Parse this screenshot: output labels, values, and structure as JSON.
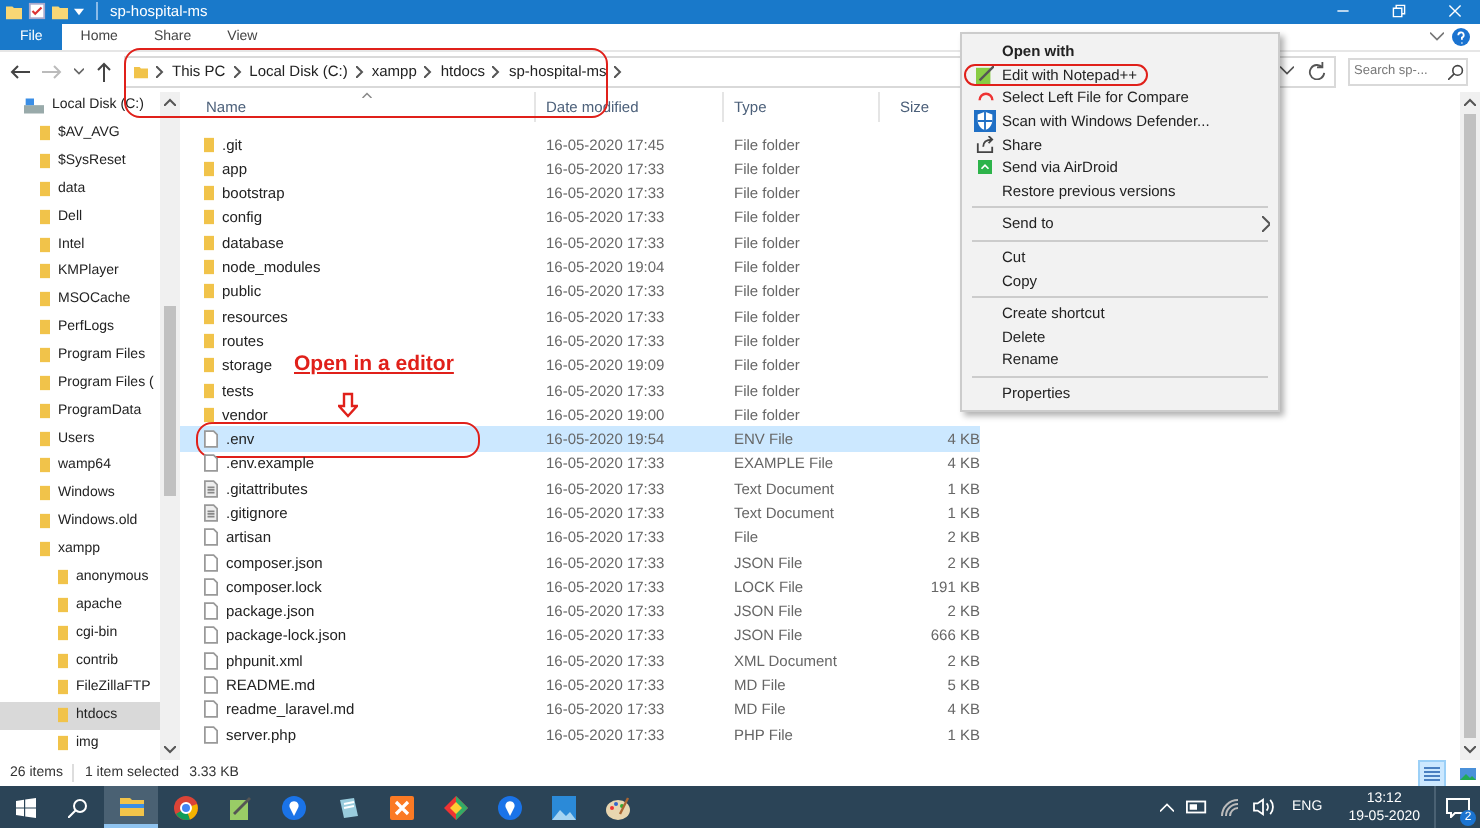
{
  "window": {
    "title": "sp-hospital-ms"
  },
  "ribbon": {
    "tabs": [
      {
        "label": "File",
        "selected": true
      },
      {
        "label": "Home",
        "selected": false
      },
      {
        "label": "Share",
        "selected": false
      },
      {
        "label": "View",
        "selected": false
      }
    ]
  },
  "address_bar": {
    "circled": true,
    "crumbs": [
      "This PC",
      "Local Disk (C:)",
      "xampp",
      "htdocs",
      "sp-hospital-ms"
    ]
  },
  "search": {
    "placeholder": "Search sp-..."
  },
  "sidebar": {
    "items": [
      {
        "label": "Local Disk (C:)",
        "kind": "drive",
        "selected": false,
        "children": [
          {
            "label": "$AV_AVG",
            "kind": "folder",
            "selected": false
          },
          {
            "label": "$SysReset",
            "kind": "folder",
            "selected": false
          },
          {
            "label": "data",
            "kind": "folder",
            "selected": false
          },
          {
            "label": "Dell",
            "kind": "folder",
            "selected": false
          },
          {
            "label": "Intel",
            "kind": "folder",
            "selected": false
          },
          {
            "label": "KMPlayer",
            "kind": "folder",
            "selected": false
          },
          {
            "label": "MSOCache",
            "kind": "folder",
            "selected": false
          },
          {
            "label": "PerfLogs",
            "kind": "folder",
            "selected": false
          },
          {
            "label": "Program Files",
            "kind": "folder",
            "selected": false
          },
          {
            "label": "Program Files (",
            "kind": "folder",
            "selected": false
          },
          {
            "label": "ProgramData",
            "kind": "folder",
            "selected": false
          },
          {
            "label": "Users",
            "kind": "folder",
            "selected": false
          },
          {
            "label": "wamp64",
            "kind": "folder",
            "selected": false
          },
          {
            "label": "Windows",
            "kind": "folder",
            "selected": false
          },
          {
            "label": "Windows.old",
            "kind": "folder",
            "selected": false
          },
          {
            "label": "xampp",
            "kind": "folder",
            "selected": false,
            "children": [
              {
                "label": "anonymous",
                "kind": "folder",
                "selected": false
              },
              {
                "label": "apache",
                "kind": "folder",
                "selected": false
              },
              {
                "label": "cgi-bin",
                "kind": "folder",
                "selected": false
              },
              {
                "label": "contrib",
                "kind": "folder",
                "selected": false
              },
              {
                "label": "FileZillaFTP",
                "kind": "folder",
                "selected": false
              },
              {
                "label": "htdocs",
                "kind": "folder",
                "selected": true
              },
              {
                "label": "img",
                "kind": "folder",
                "selected": false
              }
            ]
          }
        ]
      }
    ]
  },
  "table": {
    "columns": [
      "Name",
      "Date modified",
      "Type",
      "Size"
    ],
    "rows": [
      {
        "name": ".git",
        "date": "16-05-2020 17:45",
        "type": "File folder",
        "kind": "folder",
        "selected": false,
        "circled": false
      },
      {
        "name": "app",
        "date": "16-05-2020 17:33",
        "type": "File folder",
        "kind": "folder",
        "selected": false,
        "circled": false
      },
      {
        "name": "bootstrap",
        "date": "16-05-2020 17:33",
        "type": "File folder",
        "kind": "folder",
        "selected": false,
        "circled": false
      },
      {
        "name": "config",
        "date": "16-05-2020 17:33",
        "type": "File folder",
        "kind": "folder",
        "selected": false,
        "circled": false
      },
      {
        "name": "database",
        "date": "16-05-2020 17:33",
        "type": "File folder",
        "kind": "folder",
        "selected": false,
        "circled": false
      },
      {
        "name": "node_modules",
        "date": "16-05-2020 19:04",
        "type": "File folder",
        "kind": "folder",
        "selected": false,
        "circled": false
      },
      {
        "name": "public",
        "date": "16-05-2020 17:33",
        "type": "File folder",
        "kind": "folder",
        "selected": false,
        "circled": false
      },
      {
        "name": "resources",
        "date": "16-05-2020 17:33",
        "type": "File folder",
        "kind": "folder",
        "selected": false,
        "circled": false
      },
      {
        "name": "routes",
        "date": "16-05-2020 17:33",
        "type": "File folder",
        "kind": "folder",
        "selected": false,
        "circled": false
      },
      {
        "name": "storage",
        "date": "16-05-2020 19:09",
        "type": "File folder",
        "kind": "folder",
        "selected": false,
        "circled": false
      },
      {
        "name": "tests",
        "date": "16-05-2020 17:33",
        "type": "File folder",
        "kind": "folder",
        "selected": false,
        "circled": false
      },
      {
        "name": "vendor",
        "date": "16-05-2020 19:00",
        "type": "File folder",
        "kind": "folder",
        "selected": false,
        "circled": false
      },
      {
        "name": ".env",
        "date": "16-05-2020 19:54",
        "type": "ENV File",
        "size": "4 KB",
        "kind": "file",
        "selected": true,
        "circled": true
      },
      {
        "name": ".env.example",
        "date": "16-05-2020 17:33",
        "type": "EXAMPLE File",
        "size": "4 KB",
        "kind": "file",
        "selected": false,
        "circled": false
      },
      {
        "name": ".gitattributes",
        "date": "16-05-2020 17:33",
        "type": "Text Document",
        "size": "1 KB",
        "kind": "text",
        "selected": false,
        "circled": false
      },
      {
        "name": ".gitignore",
        "date": "16-05-2020 17:33",
        "type": "Text Document",
        "size": "1 KB",
        "kind": "text",
        "selected": false,
        "circled": false
      },
      {
        "name": "artisan",
        "date": "16-05-2020 17:33",
        "type": "File",
        "size": "2 KB",
        "kind": "file",
        "selected": false,
        "circled": false
      },
      {
        "name": "composer.json",
        "date": "16-05-2020 17:33",
        "type": "JSON File",
        "size": "2 KB",
        "kind": "file",
        "selected": false,
        "circled": false
      },
      {
        "name": "composer.lock",
        "date": "16-05-2020 17:33",
        "type": "LOCK File",
        "size": "191 KB",
        "kind": "file",
        "selected": false,
        "circled": false
      },
      {
        "name": "package.json",
        "date": "16-05-2020 17:33",
        "type": "JSON File",
        "size": "2 KB",
        "kind": "file",
        "selected": false,
        "circled": false
      },
      {
        "name": "package-lock.json",
        "date": "16-05-2020 17:33",
        "type": "JSON File",
        "size": "666 KB",
        "kind": "file",
        "selected": false,
        "circled": false
      },
      {
        "name": "phpunit.xml",
        "date": "16-05-2020 17:33",
        "type": "XML Document",
        "size": "2 KB",
        "kind": "file",
        "selected": false,
        "circled": false
      },
      {
        "name": "README.md",
        "date": "16-05-2020 17:33",
        "type": "MD File",
        "size": "5 KB",
        "kind": "file",
        "selected": false,
        "circled": false
      },
      {
        "name": "readme_laravel.md",
        "date": "16-05-2020 17:33",
        "type": "MD File",
        "size": "4 KB",
        "kind": "file",
        "selected": false,
        "circled": false
      },
      {
        "name": "server.php",
        "date": "16-05-2020 17:33",
        "type": "PHP File",
        "size": "1 KB",
        "kind": "file",
        "selected": false,
        "circled": false
      }
    ]
  },
  "annotation": {
    "text": "Open in a editor"
  },
  "context_menu": {
    "groups": [
      [
        {
          "label": "Open with",
          "kind": "default",
          "circled": false
        },
        {
          "label": "Edit with Notepad++",
          "kind": "item",
          "circled": true
        },
        {
          "label": "Select Left File for Compare",
          "kind": "item",
          "circled": false
        },
        {
          "label": "Scan with Windows Defender...",
          "kind": "item",
          "circled": false
        },
        {
          "label": "Share",
          "kind": "item",
          "circled": false
        },
        {
          "label": "Send via AirDroid",
          "kind": "item",
          "circled": false
        },
        {
          "label": "Restore previous versions",
          "kind": "item",
          "circled": false
        }
      ],
      [
        {
          "label": "Send to",
          "kind": "submenu",
          "circled": false
        }
      ],
      [
        {
          "label": "Cut",
          "kind": "item",
          "circled": false
        },
        {
          "label": "Copy",
          "kind": "item",
          "circled": false
        }
      ],
      [
        {
          "label": "Create shortcut",
          "kind": "item",
          "circled": false
        },
        {
          "label": "Delete",
          "kind": "item",
          "circled": false
        },
        {
          "label": "Rename",
          "kind": "item",
          "circled": false
        }
      ],
      [
        {
          "label": "Properties",
          "kind": "item",
          "circled": false
        }
      ]
    ]
  },
  "status_bar": {
    "items_count": "26 items",
    "selection": "1 item selected",
    "selection_size": "3.33 KB"
  },
  "taskbar": {
    "apps": [
      {
        "selected": true
      },
      {
        "selected": false
      },
      {
        "selected": false
      },
      {
        "selected": false
      },
      {
        "selected": false
      },
      {
        "selected": false
      },
      {
        "selected": false
      },
      {
        "selected": false
      },
      {
        "selected": false
      },
      {
        "selected": false
      }
    ],
    "language": "ENG",
    "time": "13:12",
    "date": "19-05-2020",
    "notifications": "2"
  }
}
